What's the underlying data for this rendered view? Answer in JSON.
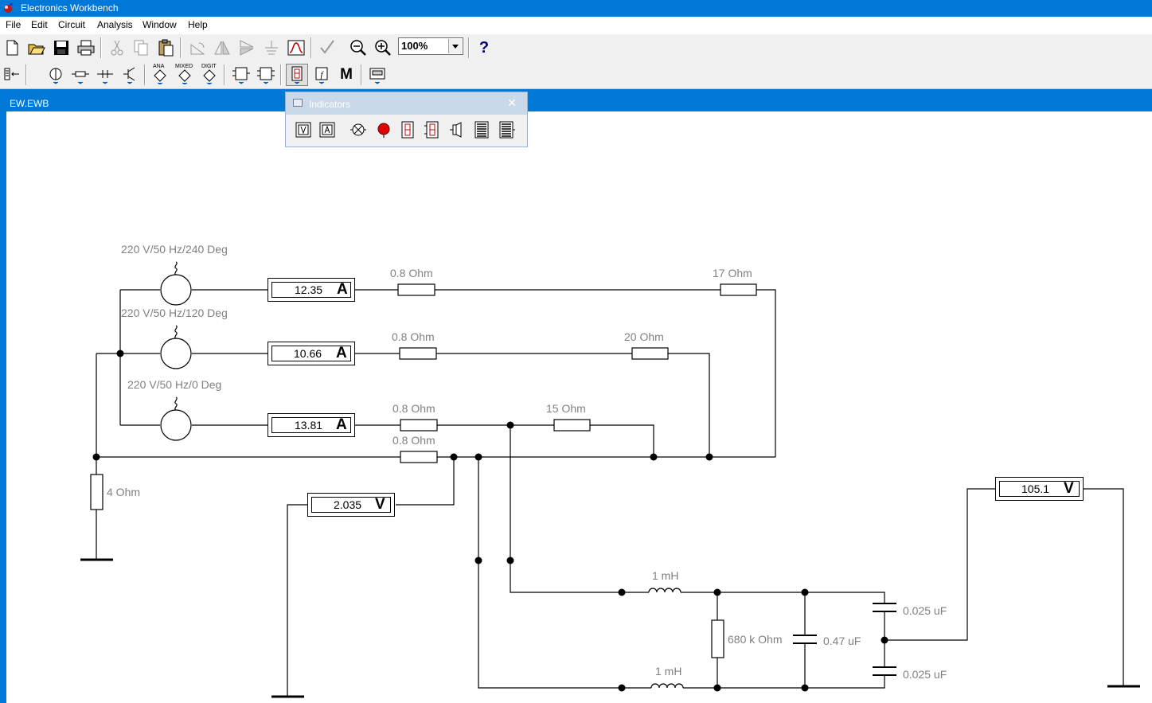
{
  "window": {
    "title": "Electronics Workbench"
  },
  "menu": {
    "file": "File",
    "edit": "Edit",
    "circuit": "Circuit",
    "analysis": "Analysis",
    "window": "Window",
    "help": "Help"
  },
  "toolbar": {
    "zoom_value": "100%",
    "help_label": "?",
    "analog_label": "ANA",
    "mixed_label": "MIXED",
    "digital_label": "DIGIT",
    "misc_label": "M"
  },
  "document": {
    "title": "EW.EWB"
  },
  "palette": {
    "title": "Indicators",
    "close": "✕"
  },
  "circuit": {
    "sources": {
      "s1": "220 V/50 Hz/240 Deg",
      "s2": "220 V/50 Hz/120 Deg",
      "s3": "220 V/50 Hz/0 Deg"
    },
    "resistors": {
      "r_line1": "0.8  Ohm",
      "r_line2": "0.8  Ohm",
      "r_line3": "0.8  Ohm",
      "r_neutral": "0.8  Ohm",
      "r_load1": "17  Ohm",
      "r_load2": "20  Ohm",
      "r_load3": "15  Ohm",
      "r_ground": "4  Ohm",
      "r_filter": "680 k Ohm"
    },
    "inductors": {
      "l_top": "1 mH",
      "l_bottom": "1 mH"
    },
    "capacitors": {
      "c_mid": "0.47 uF",
      "c_top": "0.025 uF",
      "c_bottom": "0.025 uF"
    },
    "meters": {
      "a1": {
        "value": "12.35",
        "unit": "A"
      },
      "a2": {
        "value": "10.66",
        "unit": "A"
      },
      "a3": {
        "value": "13.81",
        "unit": "A"
      },
      "v1": {
        "value": "2.035",
        "unit": "V"
      },
      "v2": {
        "value": "105.1",
        "unit": "V"
      }
    }
  },
  "colors": {
    "titlebar": "#0078d7",
    "label_gray": "#808080",
    "wire": "#000000"
  }
}
